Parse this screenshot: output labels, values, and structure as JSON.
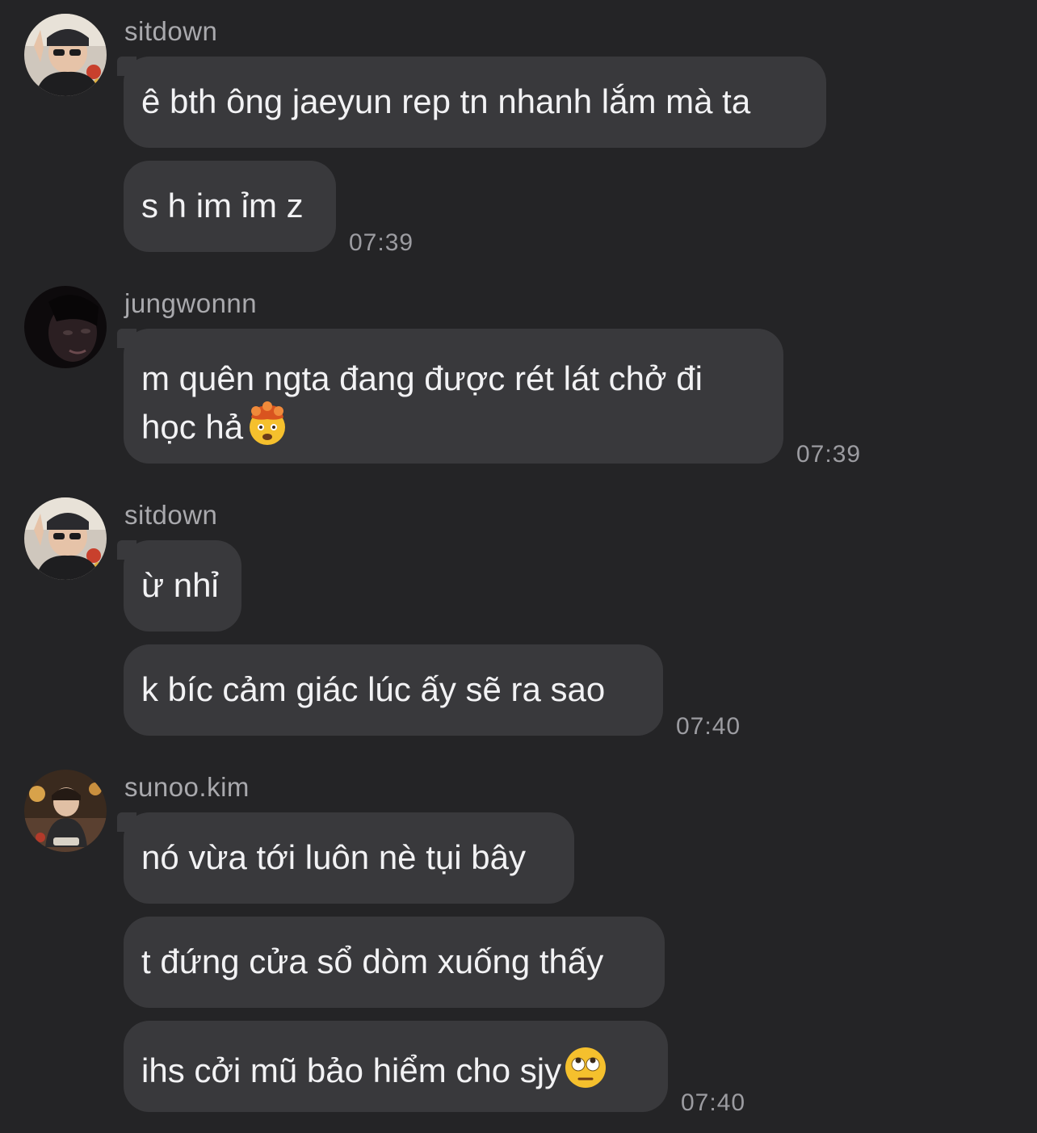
{
  "messages": {
    "group1": {
      "sender": "sitdown",
      "bubble1": "ê bth ông jaeyun rep tn nhanh lắm mà ta",
      "bubble2": "s h im ỉm z",
      "time": "07:39"
    },
    "group2": {
      "sender": "jungwonnn",
      "bubble1_line1": "m quên ngta đang được rét lát chở đi",
      "bubble1_line2": "học hả",
      "bubble1_emoji": "exploding-head-emoji",
      "time": "07:39"
    },
    "group3": {
      "sender": "sitdown",
      "bubble1": "ừ nhỉ",
      "bubble2": "k bíc cảm giác lúc ấy sẽ ra sao",
      "time": "07:40"
    },
    "group4": {
      "sender": "sunoo.kim",
      "bubble1": "nó vừa tới luôn nè tụi bây",
      "bubble2": "t đứng cửa sổ dòm xuống thấy",
      "bubble3": "ihs cởi mũ bảo hiểm cho sjy",
      "bubble3_emoji": "face-with-rolling-eyes-emoji",
      "time": "07:40"
    }
  },
  "colors": {
    "background": "#242426",
    "bubble": "#39393c",
    "text": "#f2f2f4",
    "sender": "#a9a9ad",
    "timestamp": "#9c9ca1"
  }
}
